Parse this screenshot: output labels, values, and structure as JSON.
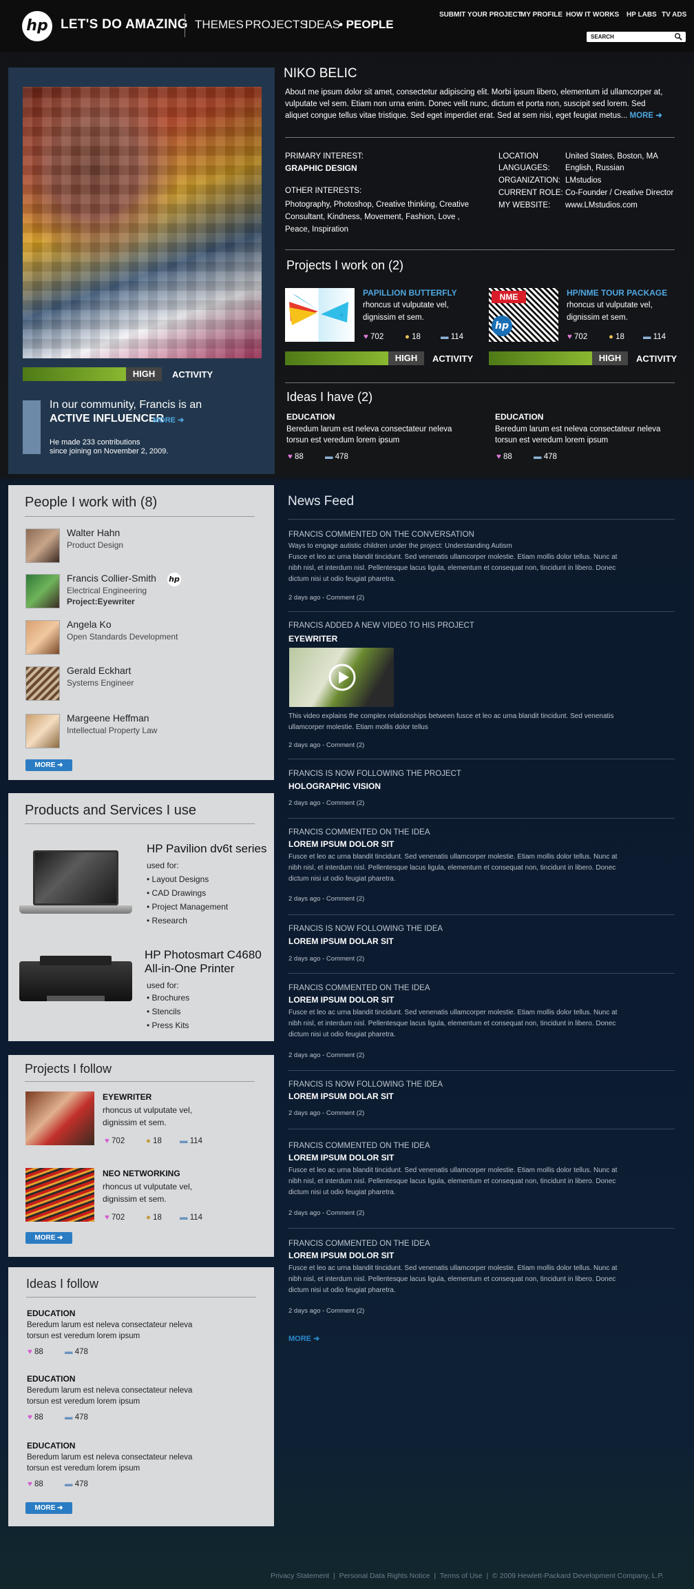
{
  "header": {
    "logo": "hp",
    "tagline": "LET'S DO AMAZING",
    "nav": [
      "THEMES",
      "PROJECTS",
      "IDEAS",
      "• PEOPLE"
    ],
    "top_links": [
      "SUBMIT YOUR PROJECT",
      "MY PROFILE",
      "HOW IT WORKS",
      "HP LABS",
      "TV ADS"
    ],
    "search_placeholder": "SEARCH"
  },
  "profile": {
    "name": "NIKO BELIC",
    "about": "About me ipsum dolor sit amet, consectetur adipiscing elit. Morbi ipsum libero, elementum id ullamcorper at, vulputate vel sem. Etiam non urna enim. Donec velit nunc, dictum et porta non, suscipit sed lorem. Sed aliquet congue tellus vitae tristique. Sed eget imperdiet erat. Sed at sem nisi, eget feugiat metus...",
    "more": "MORE",
    "activity_level": "HIGH",
    "activity_label": "ACTIVITY",
    "community_line": "In our community, Francis is an",
    "influencer": "ACTIVE INFLUENCER",
    "influencer_more": "MORE",
    "contrib_1": "He made 233 contributions",
    "contrib_2": "since joining on November 2, 2009.",
    "primary_interest_label": "PRIMARY INTEREST:",
    "primary_interest": "GRAPHIC DESIGN",
    "other_interests_label": "OTHER INTERESTS:",
    "other_interests": [
      "Photography, Photoshop, Creative thinking, Creative",
      "Consultant, Kindness, Movement, Fashion, Love ,",
      "Peace, Inspiration"
    ],
    "details": [
      {
        "label": "LOCATION",
        "value": "United States, Boston, MA"
      },
      {
        "label": "LANGUAGES:",
        "value": "English, Russian"
      },
      {
        "label": "ORGANIZATION:",
        "value": "LMstudios"
      },
      {
        "label": "CURRENT ROLE:",
        "value": "Co-Founder / Creative Director"
      },
      {
        "label": "MY WEBSITE:",
        "value": "www.LMstudios.com"
      }
    ]
  },
  "projects_work": {
    "title": "Projects I work on (2)",
    "items": [
      {
        "name": "PAPILLION BUTTERFLY",
        "desc1": "rhoncus ut vulputate vel,",
        "desc2": "dignissim et sem.",
        "likes": "702",
        "people": "18",
        "comments": "114",
        "level": "HIGH",
        "label": "ACTIVITY"
      },
      {
        "name": "HP/NME TOUR PACKAGE",
        "desc1": "rhoncus ut vulputate vel,",
        "desc2": "dignissim et sem.",
        "likes": "702",
        "people": "18",
        "comments": "114",
        "level": "HIGH",
        "label": "ACTIVITY"
      }
    ]
  },
  "ideas_have": {
    "title": "Ideas I have (2)",
    "items": [
      {
        "cat": "EDUCATION",
        "t1": "Beredum larum est neleva consectateur neleva",
        "t2": "torsun est veredum lorem ipsum",
        "likes": "88",
        "comments": "478"
      },
      {
        "cat": "EDUCATION",
        "t1": "Beredum larum est neleva consectateur neleva",
        "t2": "torsun est veredum lorem ipsum",
        "likes": "88",
        "comments": "478"
      }
    ]
  },
  "people": {
    "title": "People I work with (8)",
    "more": "MORE",
    "items": [
      {
        "name": "Walter Hahn",
        "role": "Product Design",
        "extra": ""
      },
      {
        "name": "Francis Collier-Smith",
        "role": "Electrical Engineering",
        "extra": "Project:Eyewriter"
      },
      {
        "name": "Angela Ko",
        "role": "Open Standards Development",
        "extra": ""
      },
      {
        "name": "Gerald Eckhart",
        "role": "Systems Engineer",
        "extra": ""
      },
      {
        "name": "Margeene Heffman",
        "role": "Intellectual Property Law",
        "extra": ""
      }
    ]
  },
  "products": {
    "title": "Products and Services I use",
    "items": [
      {
        "name1": "HP Pavilion dv6t series",
        "name2": "",
        "used": "used for:",
        "uses": [
          "• Layout Designs",
          "• CAD Drawings",
          "• Project Management",
          "• Research"
        ]
      },
      {
        "name1": "HP Photosmart C4680",
        "name2": "All-in-One Printer",
        "used": "used for:",
        "uses": [
          "• Brochures",
          "• Stencils",
          "• Press Kits"
        ]
      }
    ]
  },
  "follow_projects": {
    "title": "Projects I follow",
    "more": "MORE",
    "items": [
      {
        "name": "EYEWRITER",
        "d1": "rhoncus ut vulputate vel,",
        "d2": "dignissim et sem.",
        "likes": "702",
        "people": "18",
        "comments": "114"
      },
      {
        "name": "NEO NETWORKING",
        "d1": "rhoncus ut vulputate vel,",
        "d2": "dignissim et sem.",
        "likes": "702",
        "people": "18",
        "comments": "114"
      }
    ]
  },
  "follow_ideas": {
    "title": "Ideas I follow",
    "more": "MORE",
    "items": [
      {
        "cat": "EDUCATION",
        "t1": "Beredum larum est neleva consectateur neleva",
        "t2": "torsun est veredum lorem ipsum",
        "likes": "88",
        "comments": "478"
      },
      {
        "cat": "EDUCATION",
        "t1": "Beredum larum est neleva consectateur neleva",
        "t2": "torsun est veredum lorem ipsum",
        "likes": "88",
        "comments": "478"
      },
      {
        "cat": "EDUCATION",
        "t1": "Beredum larum est neleva consectateur neleva",
        "t2": "torsun est veredum lorem ipsum",
        "likes": "88",
        "comments": "478"
      }
    ]
  },
  "feed": {
    "title": "News Feed",
    "more": "MORE",
    "lorem": [
      "Fusce et leo ac urna blandit tincidunt. Sed venenatis ullamcorper molestie. Etiam mollis dolor tellus. Nunc at",
      "nibh nisl, et interdum nisl. Pellentesque lacus ligula, elementum et consequat non, tincidunt in libero. Donec",
      "dictum nisi ut odio feugiat pharetra."
    ],
    "meta": "2 days ago  -  Comment (2)",
    "e1": {
      "head": "FRANCIS COMMENTED ON THE CONVERSATION",
      "sub": "Ways to engage autistic children under the project: Understanding Autism"
    },
    "e2": {
      "head": "FRANCIS ADDED A NEW VIDEO TO HIS PROJECT",
      "sub": "EYEWRITER",
      "video1": "This video explains the complex relationships between fusce et leo ac urna blandit tincidunt. Sed venenatis",
      "video2": "ullamcorper molestie. Etiam mollis dolor tellus"
    },
    "e3": {
      "head": "FRANCIS IS NOW FOLLOWING THE PROJECT",
      "sub": "HOLOGRAPHIC VISION"
    },
    "e4": {
      "head": "FRANCIS COMMENTED ON THE IDEA",
      "sub": "LOREM IPSUM DOLOR SIT"
    },
    "e5": {
      "head": "FRANCIS IS NOW FOLLOWING THE IDEA",
      "sub": "LOREM IPSUM DOLAR SIT"
    },
    "e6": {
      "head": "FRANCIS COMMENTED ON THE IDEA",
      "sub": "LOREM IPSUM DOLOR SIT"
    },
    "e7": {
      "head": "FRANCIS IS NOW FOLLOWING THE IDEA",
      "sub": "LOREM IPSUM DOLAR SIT"
    },
    "e8": {
      "head": "FRANCIS COMMENTED ON THE IDEA",
      "sub": "LOREM IPSUM DOLOR SIT"
    },
    "e9": {
      "head": "FRANCIS COMMENTED ON THE IDEA",
      "sub": "LOREM IPSUM DOLOR SIT"
    }
  },
  "footer": {
    "privacy": "Privacy Statement",
    "rights": "Personal Data Rights Notice",
    "terms": "Terms of Use",
    "copyright": "© 2009 Hewlett-Packard Development Company, L.P."
  },
  "colors": {
    "accent_blue": "#2b7dc3",
    "activity_green": "#8ab830",
    "link_blue": "#4fa7e0"
  },
  "icons": [
    "heart-icon",
    "people-icon",
    "comment-icon",
    "search-icon",
    "arrow-right-icon",
    "play-icon"
  ]
}
